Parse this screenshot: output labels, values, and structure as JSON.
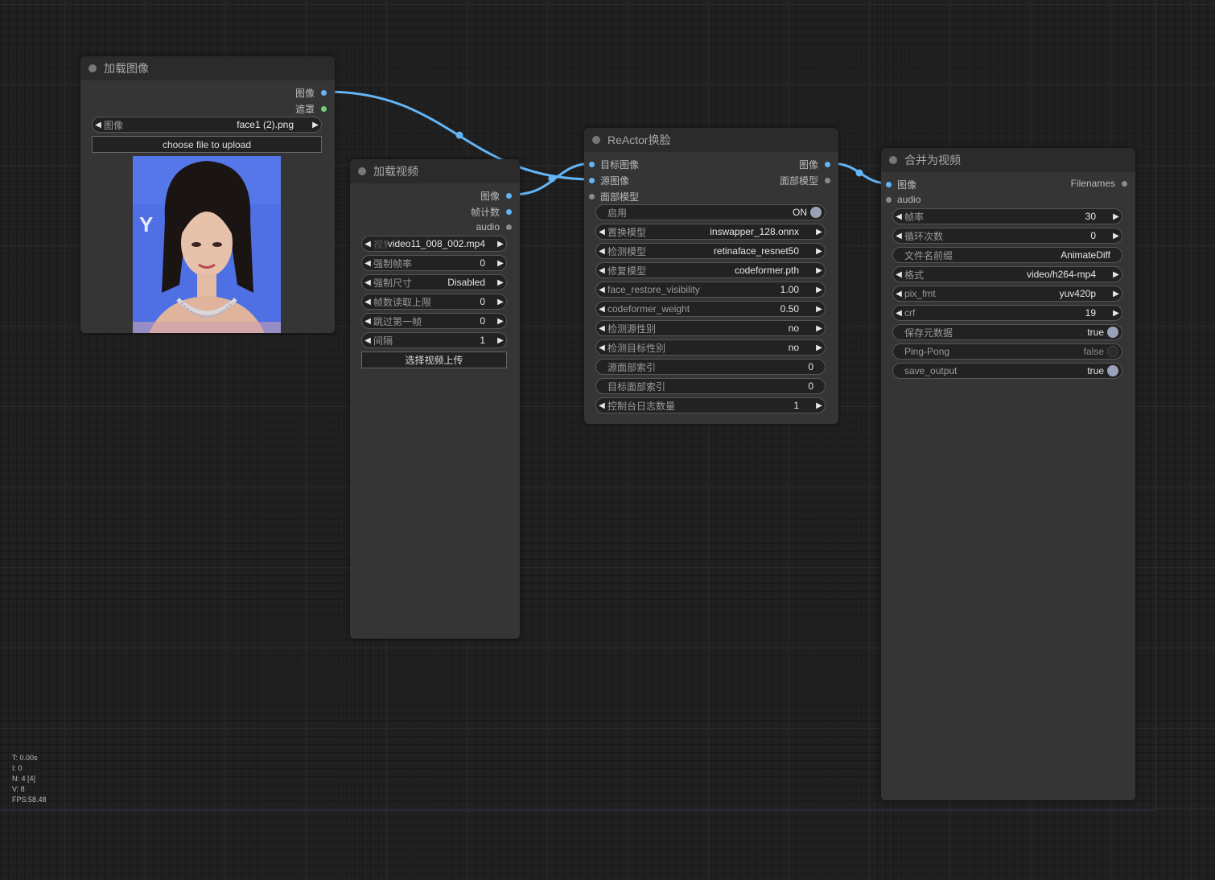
{
  "stats": {
    "time": "T: 0.00s",
    "iter": "I: 0",
    "nodes": "N: 4 [4]",
    "vertices": "V: 8",
    "fps": "FPS:58.48"
  },
  "load_image": {
    "title": "加载图像",
    "outputs": [
      "图像",
      "遮罩"
    ],
    "image_widget": {
      "label": "图像",
      "value": "face1 (2).png"
    },
    "upload_button": "choose file to upload",
    "preview_icon": "portrait-photo"
  },
  "load_video": {
    "title": "加载视频",
    "outputs": [
      "图像",
      "帧计数",
      "audio"
    ],
    "widgets": [
      {
        "label": "视频",
        "value": "video11_008_002.mp4"
      },
      {
        "label": "强制帧率",
        "value": "0"
      },
      {
        "label": "强制尺寸",
        "value": "Disabled"
      },
      {
        "label": "帧数读取上限",
        "value": "0"
      },
      {
        "label": "跳过第一帧",
        "value": "0"
      },
      {
        "label": "间隔",
        "value": "1"
      }
    ],
    "upload_button": "选择视频上传"
  },
  "reactor": {
    "title": "ReActor换脸",
    "inputs": [
      "目标图像",
      "源图像",
      "面部模型"
    ],
    "outputs": [
      "图像",
      "面部模型"
    ],
    "enable": {
      "label": "启用",
      "value": "ON"
    },
    "widgets": [
      {
        "label": "置换模型",
        "value": "inswapper_128.onnx"
      },
      {
        "label": "检测模型",
        "value": "retinaface_resnet50"
      },
      {
        "label": "修复模型",
        "value": "codeformer.pth"
      },
      {
        "label": "face_restore_visibility",
        "value": "1.00"
      },
      {
        "label": "codeformer_weight",
        "value": "0.50"
      },
      {
        "label": "检测源性别",
        "value": "no"
      },
      {
        "label": "检测目标性别",
        "value": "no"
      }
    ],
    "source_index": {
      "label": "源面部索引",
      "value": "0"
    },
    "target_index": {
      "label": "目标面部索引",
      "value": "0"
    },
    "log_level": {
      "label": "控制台日志数量",
      "value": "1"
    }
  },
  "video_combine": {
    "title": "合并为视频",
    "inputs": [
      "图像",
      "audio"
    ],
    "outputs": [
      "Filenames"
    ],
    "widgets": [
      {
        "label": "帧率",
        "value": "30"
      },
      {
        "label": "循环次数",
        "value": "0"
      }
    ],
    "filename_prefix": {
      "label": "文件名前缀",
      "value": "AnimateDiff"
    },
    "format_widgets": [
      {
        "label": "格式",
        "value": "video/h264-mp4"
      },
      {
        "label": "pix_fmt",
        "value": "yuv420p"
      },
      {
        "label": "crf",
        "value": "19"
      }
    ],
    "toggles": [
      {
        "label": "保存元数据",
        "value": "true",
        "on": true
      },
      {
        "label": "Ping-Pong",
        "value": "false",
        "on": false
      },
      {
        "label": "save_output",
        "value": "true",
        "on": true
      }
    ]
  },
  "colors": {
    "link": "#64b5f6",
    "mask_slot": "#6fd174",
    "node_bg": "#353535",
    "title_bg": "#2b2b2b",
    "canvas_bg": "#202020"
  }
}
